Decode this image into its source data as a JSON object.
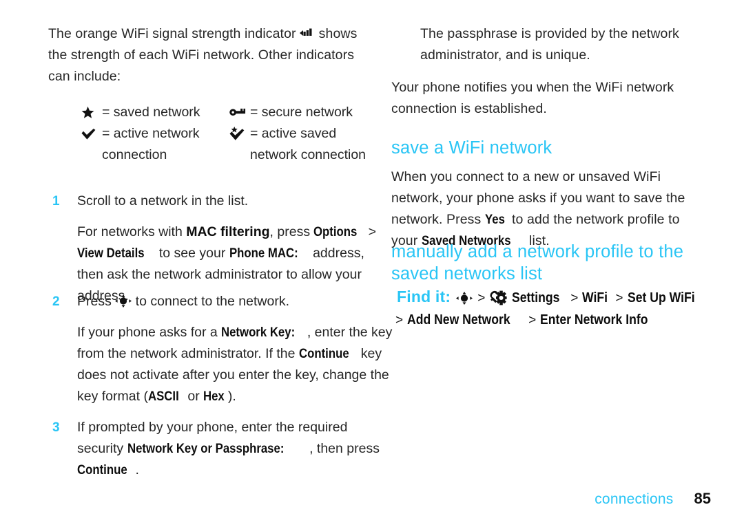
{
  "colors": {
    "accent": "#29c5f5",
    "body_text": "#262626",
    "strong_text": "#0d0d0d"
  },
  "left_column": {
    "intro": {
      "part1": "The orange WiFi signal strength indicator ",
      "icon": "wifi-signal-icon",
      "part2": " shows the strength of each WiFi network. Other indicators can include:"
    },
    "legend": [
      {
        "icon": "star-icon",
        "icon_name": "star-icon",
        "text": "= saved network"
      },
      {
        "icon": "key-icon",
        "icon_name": "key-icon",
        "text": "= secure network"
      },
      {
        "icon": "checkmark-icon",
        "icon_name": "checkmark-icon",
        "text": "= active network connection"
      },
      {
        "icon": "star-checkmark-icon",
        "icon_name": "star-checkmark-icon",
        "text": "= active saved network connection"
      }
    ],
    "steps": [
      {
        "number": "1",
        "line": "Scroll to a network in the list.",
        "detail_segments": [
          {
            "type": "text",
            "value": "For networks with "
          },
          {
            "type": "bold",
            "value": "MAC filtering"
          },
          {
            "type": "text",
            "value": ", press "
          },
          {
            "type": "ui",
            "value": "Options"
          },
          {
            "type": "text",
            "value": " > "
          },
          {
            "type": "ui",
            "value": "View Details"
          },
          {
            "type": "text",
            "value": " to see your "
          },
          {
            "type": "ui",
            "value": "Phone MAC:"
          },
          {
            "type": "text",
            "value": " address, then ask the network administrator to allow your address."
          }
        ]
      },
      {
        "number": "2",
        "line_prefix": "Press ",
        "line_icon": "nav-key-icon",
        "line_suffix": " to connect to the network.",
        "detail_segments": [
          {
            "type": "text",
            "value": "If your phone asks for a "
          },
          {
            "type": "ui",
            "value": "Network Key:"
          },
          {
            "type": "text",
            "value": ", enter the key from the network administrator. If the "
          },
          {
            "type": "ui",
            "value": "Continue"
          },
          {
            "type": "text",
            "value": " key does not activate after you enter the key, change the key format ("
          },
          {
            "type": "ui",
            "value": "ASCII"
          },
          {
            "type": "text",
            "value": " or "
          },
          {
            "type": "ui",
            "value": "Hex"
          },
          {
            "type": "text",
            "value": ")."
          }
        ]
      },
      {
        "number": "3",
        "detail_segments": [
          {
            "type": "text",
            "value": "If prompted by your phone, enter the required security "
          },
          {
            "type": "ui",
            "value": "Network Key or Passphrase:"
          },
          {
            "type": "text",
            "value": ", then press "
          },
          {
            "type": "ui",
            "value": "Continue"
          },
          {
            "type": "text",
            "value": "."
          }
        ]
      }
    ]
  },
  "right_column": {
    "note": "The passphrase is provided by the network administrator, and is unique.",
    "paragraph_notify": "Your phone notifies you when the WiFi network connection is established.",
    "heading_save": "save a WiFi network",
    "save_segments": [
      {
        "type": "text",
        "value": "When you connect to a new or unsaved WiFi network, your phone asks if you want to save the network. Press "
      },
      {
        "type": "ui",
        "value": "Yes"
      },
      {
        "type": "text",
        "value": " to add the network profile to your "
      },
      {
        "type": "ui",
        "value": "Saved Networks"
      },
      {
        "type": "text",
        "value": " list."
      }
    ],
    "heading_manual": "manually add a network profile to the saved networks list",
    "find_it": {
      "label": "Find it:",
      "nav_icon": "nav-key-icon",
      "separator": ">",
      "settings_icon": "settings-wrench-gear-icon",
      "path_1": "Settings",
      "path_2": "WiFi",
      "path_3": "Set Up WiFi",
      "path_4": "Add New Network",
      "path_5": "Enter Network Info"
    }
  },
  "footer": {
    "chapter": "connections",
    "page_number": "85"
  }
}
